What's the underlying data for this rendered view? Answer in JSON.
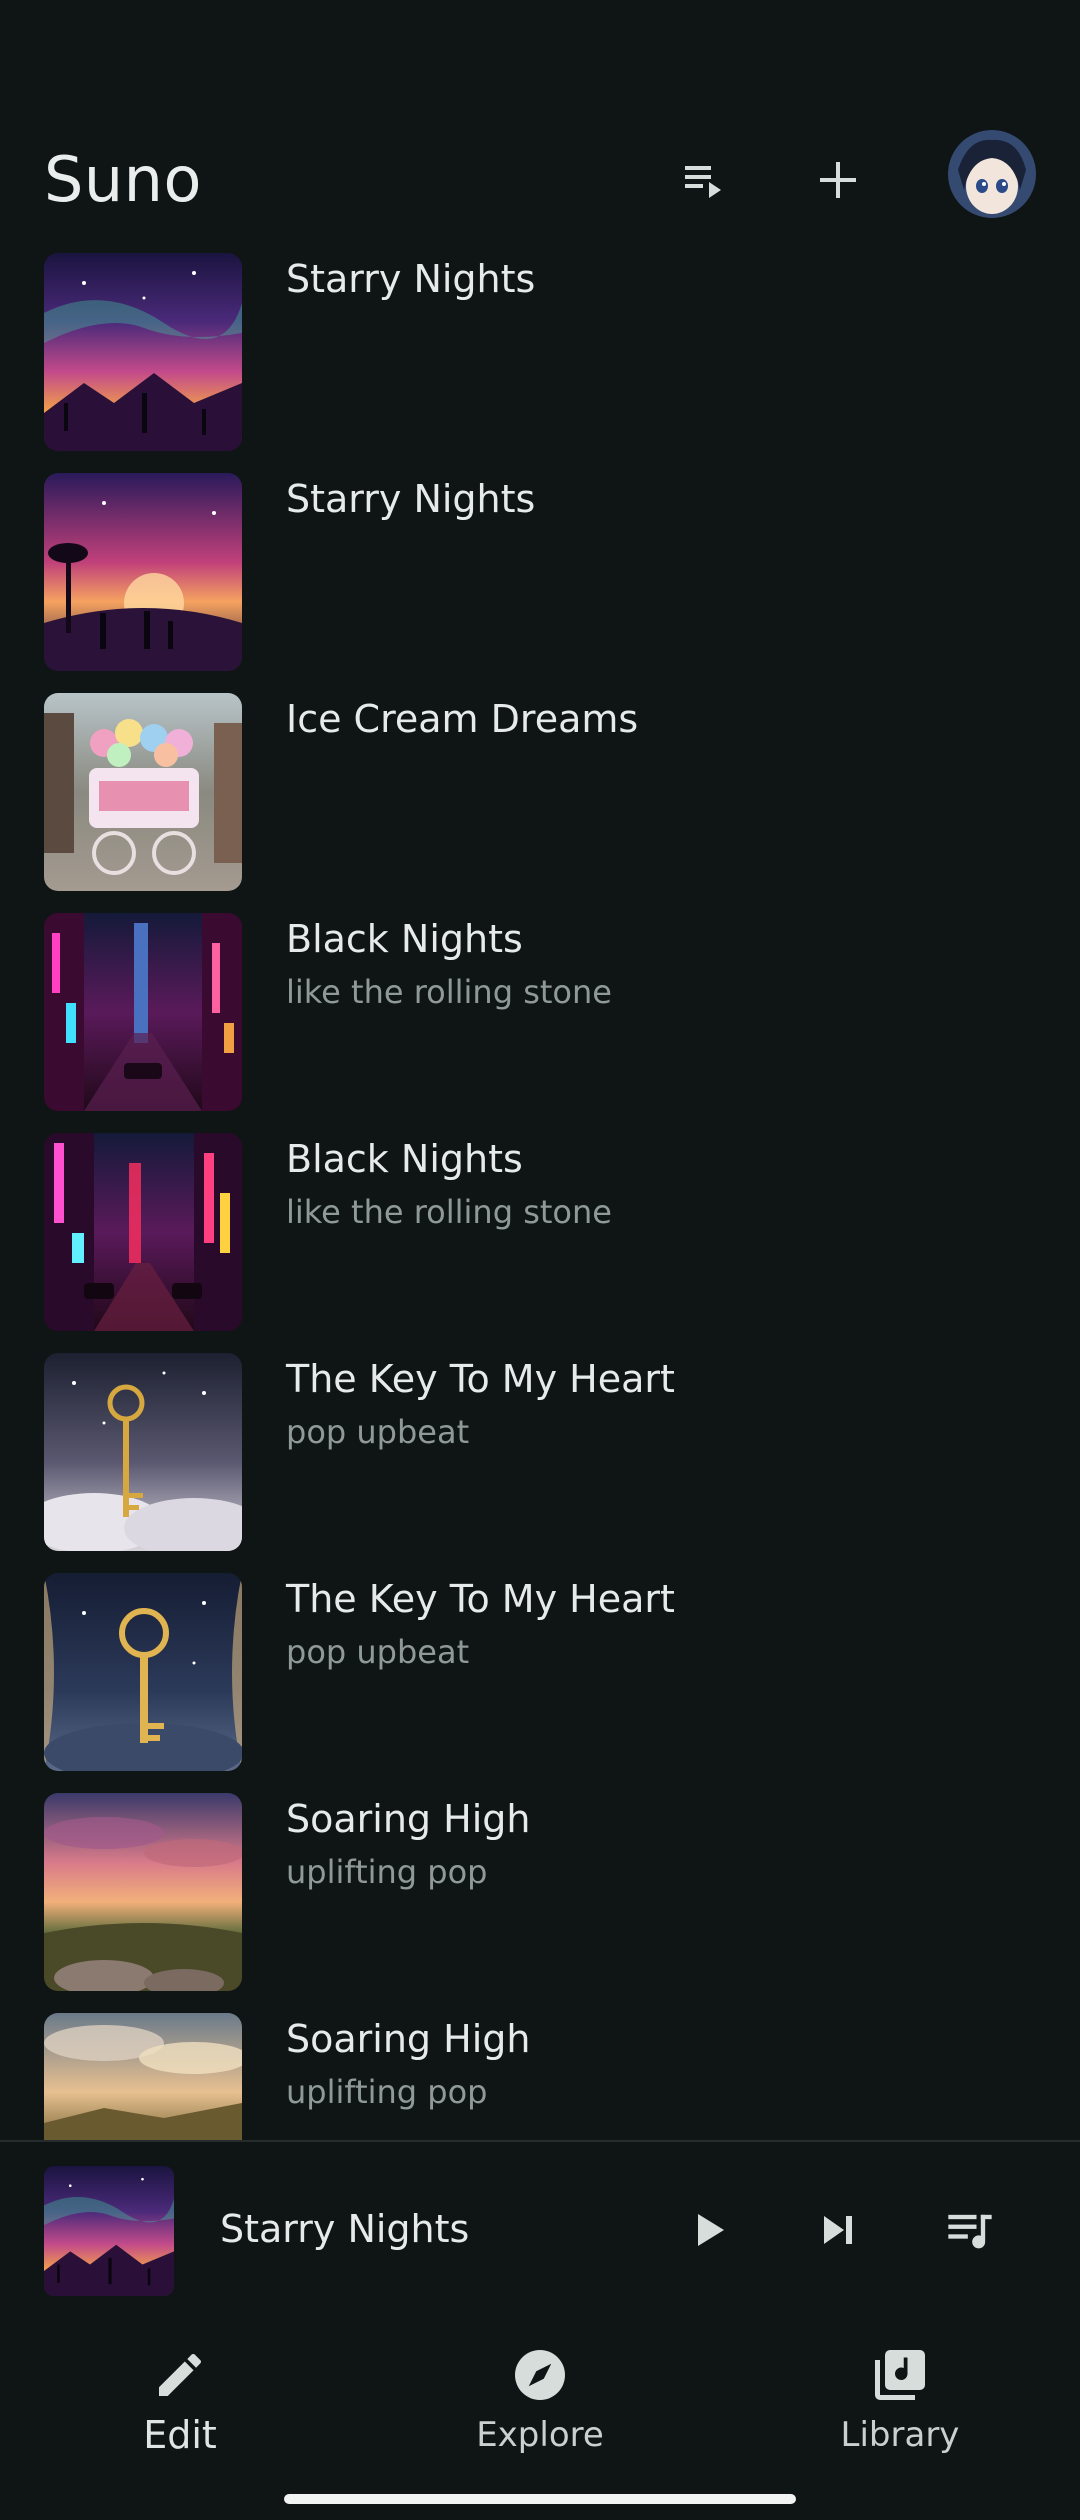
{
  "app": {
    "title": "Suno"
  },
  "header": {
    "queue_icon": "playlist-play-icon",
    "add_icon": "plus-icon",
    "avatar_icon": "anime-avatar"
  },
  "songs": [
    {
      "title": "Starry Nights",
      "subtitle": "",
      "cover": "aurora-mountains-silhouettes"
    },
    {
      "title": "Starry Nights",
      "subtitle": "",
      "cover": "sunset-family-silhouettes"
    },
    {
      "title": "Ice Cream Dreams",
      "subtitle": "",
      "cover": "ice-cream-cart"
    },
    {
      "title": "Black Nights",
      "subtitle": "like the rolling stone",
      "cover": "neon-city-street"
    },
    {
      "title": "Black Nights",
      "subtitle": "like the rolling stone",
      "cover": "neon-city-street-2"
    },
    {
      "title": "The Key To My Heart",
      "subtitle": "pop upbeat",
      "cover": "golden-key-clouds"
    },
    {
      "title": "The Key To My Heart",
      "subtitle": "pop upbeat",
      "cover": "golden-key-night"
    },
    {
      "title": "Soaring High",
      "subtitle": "uplifting pop",
      "cover": "sunset-landscape"
    },
    {
      "title": "Soaring High",
      "subtitle": "uplifting pop",
      "cover": "cloudy-valley"
    }
  ],
  "mini_player": {
    "title": "Starry Nights",
    "play_icon": "play-icon",
    "next_icon": "skip-next-icon",
    "queue_icon": "queue-music-icon"
  },
  "nav": {
    "edit_label": "Edit",
    "explore_label": "Explore",
    "library_label": "Library"
  },
  "colors": {
    "background": "#0f1414",
    "text_primary": "#e6ebea",
    "text_secondary": "#8f9997"
  }
}
